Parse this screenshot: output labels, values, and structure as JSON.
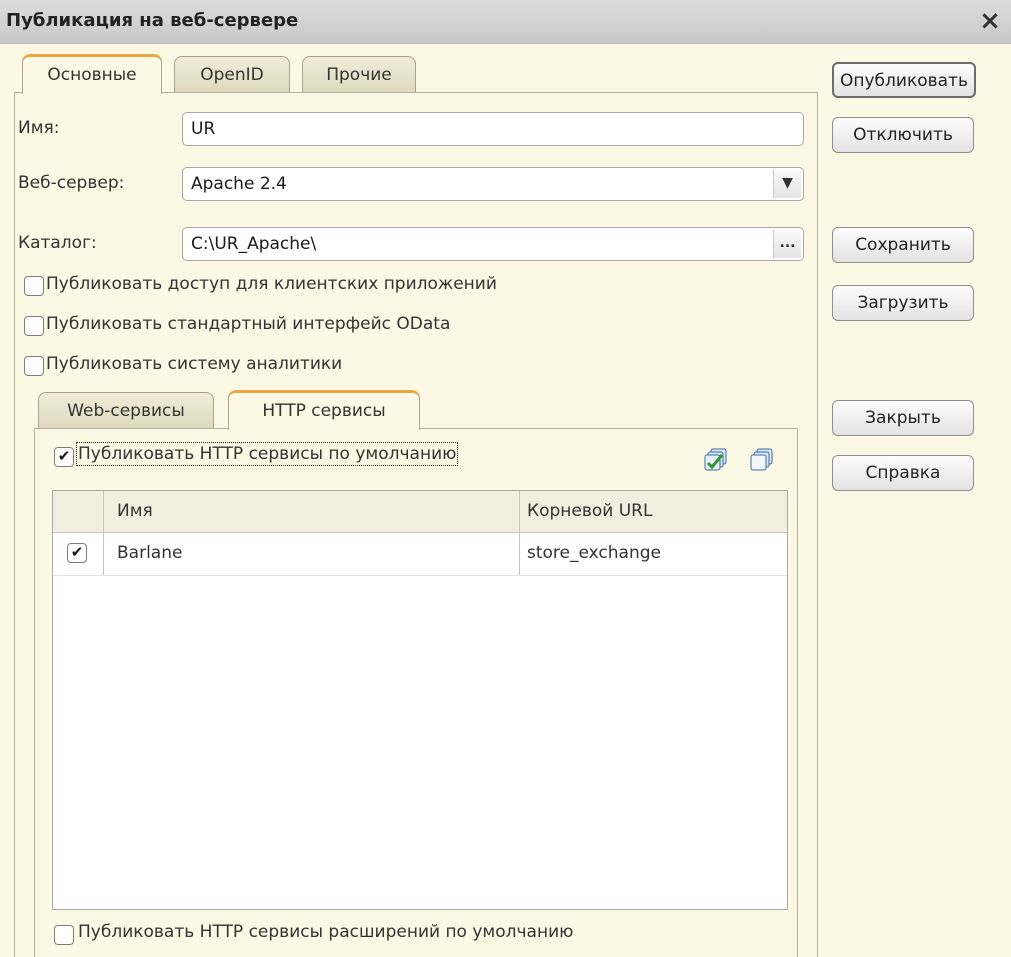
{
  "window": {
    "title": "Публикация на веб-сервере"
  },
  "tabs": [
    "Основные",
    "OpenID",
    "Прочие"
  ],
  "form": {
    "name_label": "Имя:",
    "name_value": "UR",
    "webserver_label": "Веб-сервер:",
    "webserver_value": "Apache 2.4",
    "catalog_label": "Каталог:",
    "catalog_value": "C:\\UR_Apache\\",
    "catalog_button": "...",
    "checkboxes": [
      {
        "label": "Публиковать доступ для клиентских приложений",
        "checked": false
      },
      {
        "label": "Публиковать стандартный интерфейс OData",
        "checked": false
      },
      {
        "label": "Публиковать систему аналитики",
        "checked": false
      }
    ]
  },
  "inner_tabs": [
    "Web-сервисы",
    "HTTP сервисы"
  ],
  "http": {
    "publish_default_label": "Публиковать HTTP сервисы по умолчанию",
    "publish_default_checked": true,
    "columns": [
      "Имя",
      "Корневой URL"
    ],
    "rows": [
      {
        "checked": true,
        "name": "Barlane",
        "url": "store_exchange"
      }
    ],
    "publish_ext_label": "Публиковать HTTP сервисы расширений по умолчанию",
    "publish_ext_checked": false
  },
  "buttons": {
    "publish": "Опубликовать",
    "disable": "Отключить",
    "save": "Сохранить",
    "load": "Загрузить",
    "close": "Закрыть",
    "help": "Справка"
  },
  "icons": {
    "close": "×",
    "check": "✔",
    "dropdown": "▼"
  },
  "colors": {
    "background": "#fbf8e4",
    "active_tab_accent": "#e9a845"
  }
}
